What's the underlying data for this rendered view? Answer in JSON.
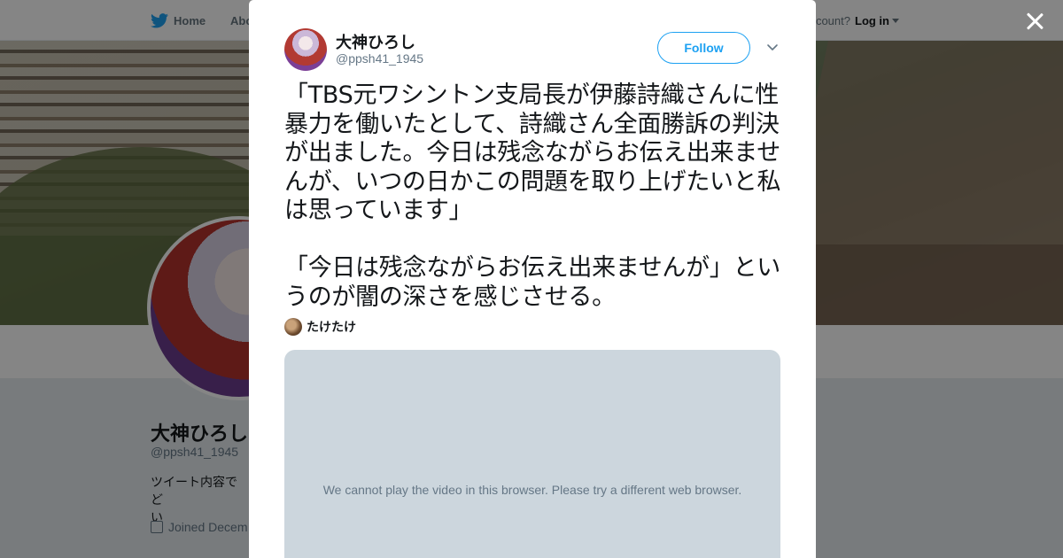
{
  "background_page": {
    "nav": {
      "home_label": "Home",
      "about_label": "Abo",
      "account_prompt": "ccount?",
      "login_label": "Log in"
    },
    "profile": {
      "name": "大神ひろし",
      "handle": "@ppsh41_1945",
      "bio_line1": "ツイート内容でど",
      "bio_line2": "い",
      "joined": "Joined Decem"
    }
  },
  "modal": {
    "author": {
      "name": "大神ひろし",
      "handle": "@ppsh41_1945"
    },
    "follow_label": "Follow",
    "tweet": {
      "paragraph1": "「TBS元ワシントン支局長が伊藤詩織さんに性暴力を働いたとして、詩織さん全面勝訴の判決が出ました。今日は残念ながらお伝え出来ませんが、いつの日かこの問題を取り上げたいと私は思っています」",
      "paragraph2": "「今日は残念ながらお伝え出来ませんが」というのが闇の深さを感じさせる。"
    },
    "mention_name": "たけたけ",
    "video_message": "We cannot play the video in this browser. Please try a different web browser."
  },
  "colors": {
    "twitter_blue": "#1da1f2",
    "text_primary": "#14171a",
    "text_secondary": "#657786",
    "video_placeholder": "#ccd6dd"
  },
  "icons": {
    "home": "twitter-bird-icon",
    "close": "close-icon",
    "more": "chevron-down-icon",
    "joined": "calendar-icon"
  }
}
